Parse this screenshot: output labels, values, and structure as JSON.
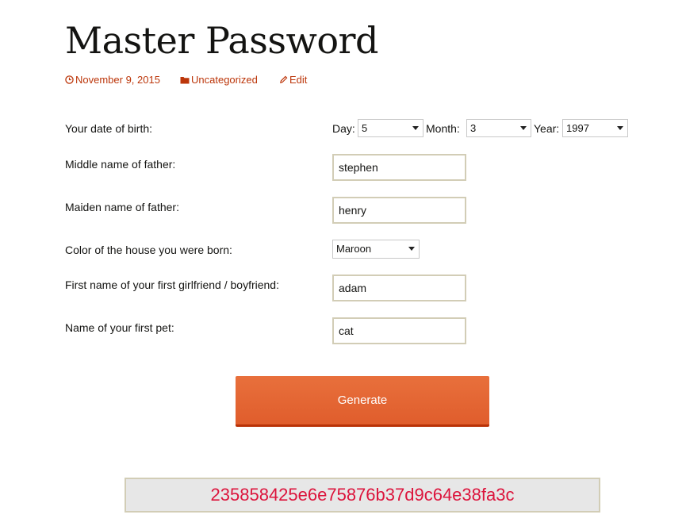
{
  "post": {
    "title": "Master Password",
    "date": "November 9, 2015",
    "category": "Uncategorized",
    "edit": "Edit"
  },
  "icons": {
    "date": "clock-icon",
    "category": "folder-icon",
    "edit": "pencil-icon"
  },
  "form": {
    "dob": {
      "label": "Your date of birth:",
      "day_label": "Day:",
      "day_value": "5",
      "month_label": "Month:",
      "month_value": "3",
      "year_label": "Year:",
      "year_value": "1997"
    },
    "father_middle": {
      "label": "Middle name of father:",
      "value": "stephen"
    },
    "father_maiden": {
      "label": "Maiden name of father:",
      "value": "henry"
    },
    "house_color": {
      "label": "Color of the house you were born:",
      "value": "Maroon"
    },
    "first_partner": {
      "label": "First name of your first girlfriend / boyfriend:",
      "value": "adam"
    },
    "first_pet": {
      "label": "Name of your first pet:",
      "value": "cat"
    },
    "generate_label": "Generate"
  },
  "result": {
    "hash": "235858425e6e75876b37d9c64e38fa3c"
  },
  "colors": {
    "accent": "#bc360a",
    "button": "#e05d2c",
    "result_text": "#dc143c"
  }
}
